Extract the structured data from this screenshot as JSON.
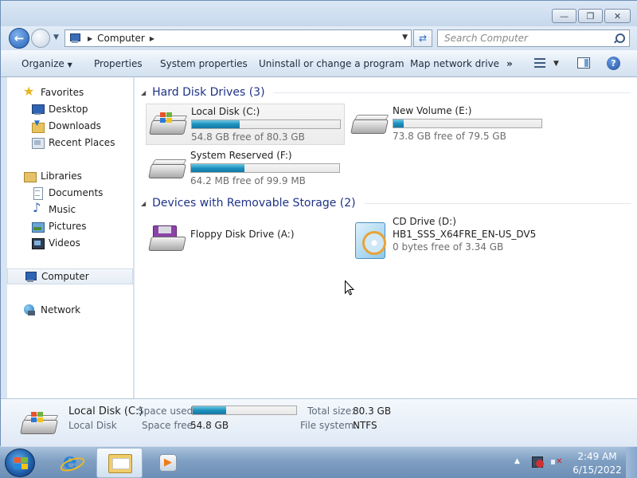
{
  "window": {
    "caption": {
      "minimize": "—",
      "maximize": "❐",
      "close": "✕"
    }
  },
  "nav": {
    "address_crumbs": [
      "Computer"
    ],
    "search_placeholder": "Search Computer"
  },
  "toolbar": {
    "organize": "Organize",
    "properties": "Properties",
    "system_properties": "System properties",
    "uninstall": "Uninstall or change a program",
    "map_drive": "Map network drive",
    "more": "»"
  },
  "sidebar": {
    "favorites": "Favorites",
    "desktop": "Desktop",
    "downloads": "Downloads",
    "recent": "Recent Places",
    "libraries": "Libraries",
    "documents": "Documents",
    "music": "Music",
    "pictures": "Pictures",
    "videos": "Videos",
    "computer": "Computer",
    "network": "Network"
  },
  "content": {
    "groups": {
      "hard_disks": "Hard Disk Drives (3)",
      "removable": "Devices with Removable Storage (2)"
    },
    "drives": {
      "c": {
        "name": "Local Disk (C:)",
        "free": "54.8 GB free of 80.3 GB",
        "used_fraction": 0.32
      },
      "e": {
        "name": "New Volume (E:)",
        "free": "73.8 GB free of 79.5 GB",
        "used_fraction": 0.07
      },
      "f": {
        "name": "System Reserved (F:)",
        "free": "64.2 MB free of 99.9 MB",
        "used_fraction": 0.36
      },
      "a": {
        "name": "Floppy Disk Drive (A:)"
      },
      "d": {
        "name": "CD Drive (D:)",
        "label": "HB1_SSS_X64FRE_EN-US_DV5",
        "free": "0 bytes free of 3.34 GB"
      }
    }
  },
  "details": {
    "name": "Local Disk (C:)",
    "type": "Local Disk",
    "space_used_label": "Space used:",
    "space_free_label": "Space free:",
    "space_free": "54.8 GB",
    "total_size_label": "Total size:",
    "total_size": "80.3 GB",
    "file_system_label": "File system:",
    "file_system": "NTFS",
    "used_fraction": 0.32
  },
  "taskbar": {
    "time": "2:49 AM",
    "date": "6/15/2022"
  },
  "colors": {
    "accent": "#1c91bd",
    "group_header": "#1e3287",
    "taskbar": "#7f9fc2"
  }
}
